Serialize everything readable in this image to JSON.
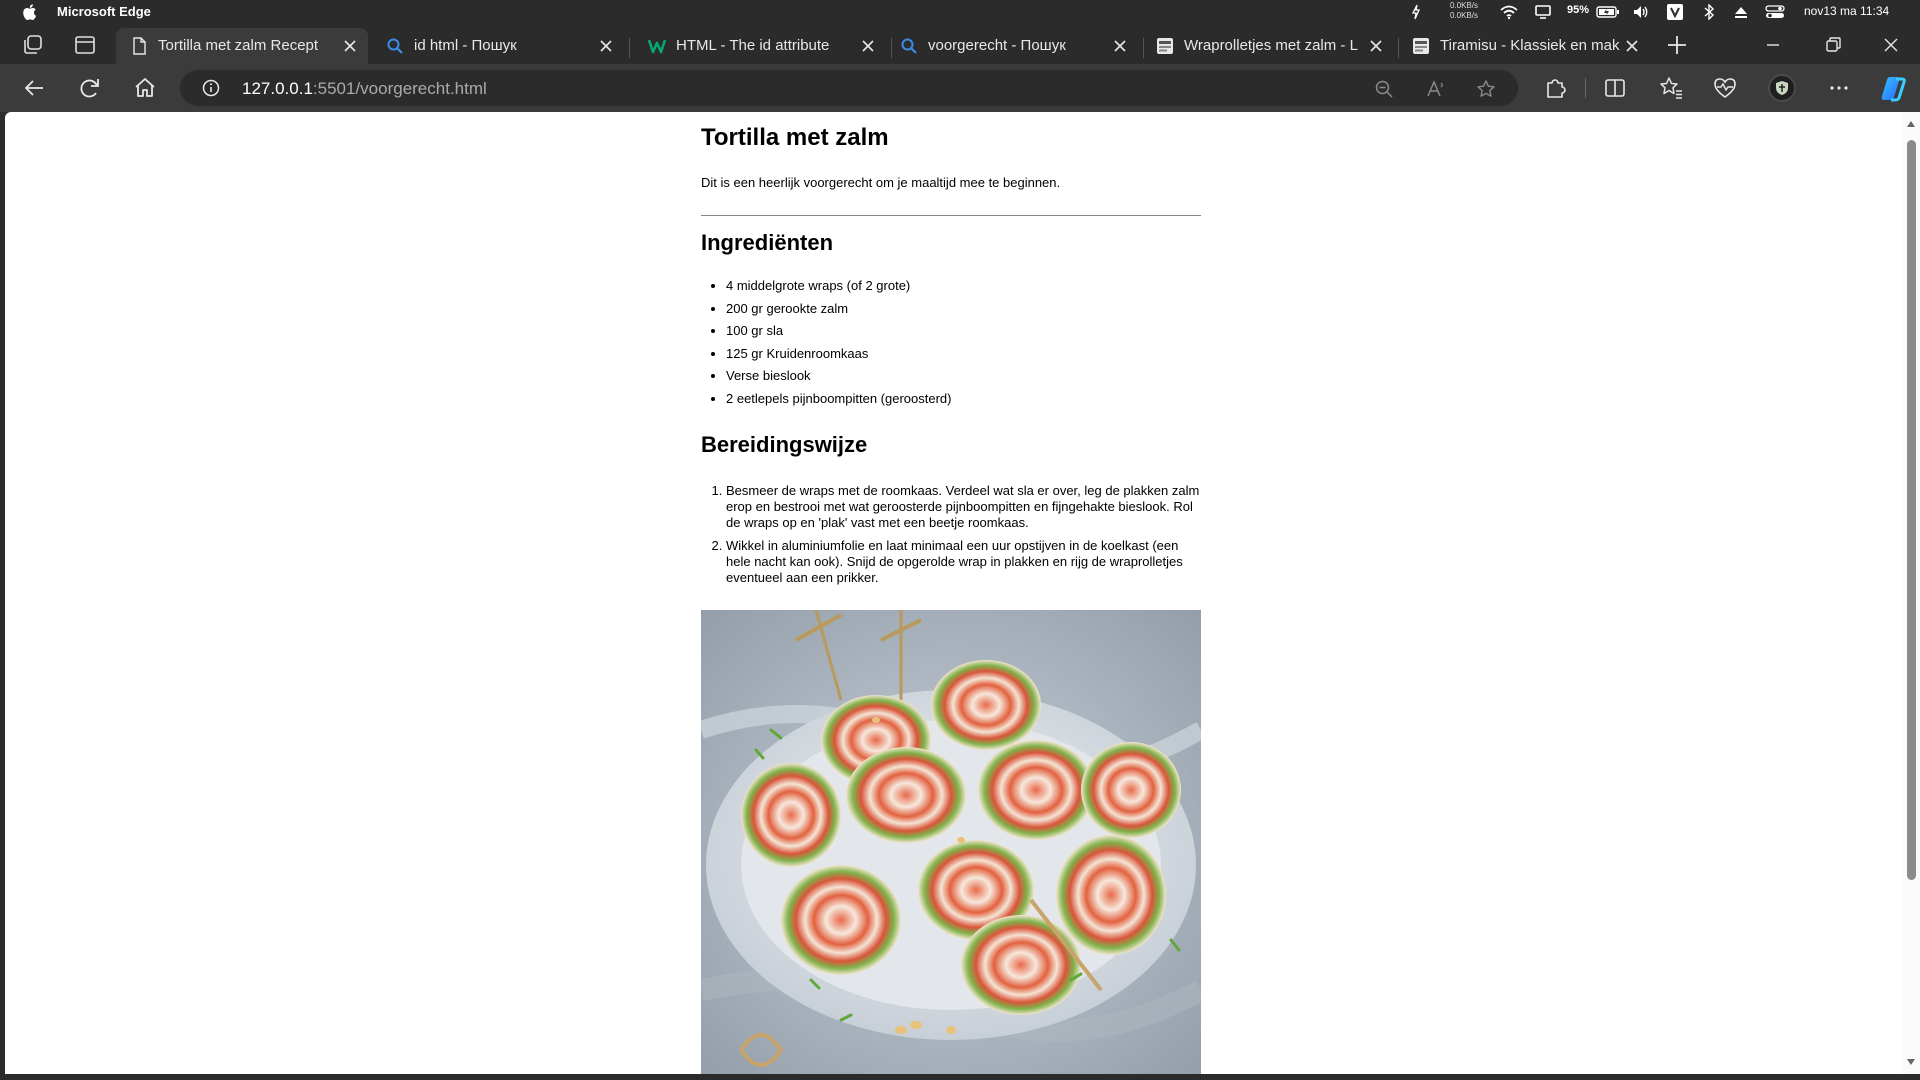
{
  "menubar": {
    "app_name": "Microsoft Edge",
    "net_up": "0.0KB/s",
    "net_down": "0.0KB/s",
    "battery": "95%",
    "datetime": "nov13 ma  11:34"
  },
  "tabs": [
    {
      "title": "Tortilla met zalm Recept",
      "icon": "page-icon",
      "active": true
    },
    {
      "title": "id html - Пошук",
      "icon": "search-icon",
      "active": false
    },
    {
      "title": "HTML - The id attribute",
      "icon": "w3schools-icon",
      "active": false
    },
    {
      "title": "voorgerecht - Пошук",
      "icon": "search-icon",
      "active": false
    },
    {
      "title": "Wraprolletjes met zalm - L",
      "icon": "site-icon",
      "active": false
    },
    {
      "title": "Tiramisu - Klassiek en mak",
      "icon": "site-icon",
      "active": false
    }
  ],
  "address": {
    "host": "127.0.0.1",
    "rest": ":5501/voorgerecht.html"
  },
  "page": {
    "title": "Tortilla met zalm",
    "intro": "Dit is een heerlijk voorgerecht om je maaltijd mee te beginnen.",
    "ingredients_heading": "Ingrediënten",
    "ingredients": [
      "4 middelgrote wraps (of 2 grote)",
      "200 gr gerookte zalm",
      "100 gr sla",
      "125 gr Kruidenroomkaas",
      "Verse bieslook",
      "2 eetlepels pijnboompitten (geroosterd)"
    ],
    "steps_heading": "Bereidingswijze",
    "steps": [
      "Besmeer de wraps met de roomkaas. Verdeel wat sla er over, leg de plakken zalm erop en bestrooi met wat geroosterde pijnboompitten en fijngehakte bieslook. Rol de wraps op en 'plak' vast met een beetje roomkaas.",
      "Wikkel in aluminiumfolie en laat minimaal een uur opstijven in de koelkast (een hele nacht kan ook). Snijd de opgerolde wrap in plakken en rijg de wraprolletjes eventueel aan een prikker."
    ]
  },
  "colors": {
    "chrome_dark": "#2b2b2b",
    "chrome_toolbar": "#3b3b3b",
    "page_bg": "#ffffff",
    "search_icon": "#3a8de5",
    "w3schools_green": "#04aa6d",
    "copilot_blue": "#2f8cff"
  }
}
